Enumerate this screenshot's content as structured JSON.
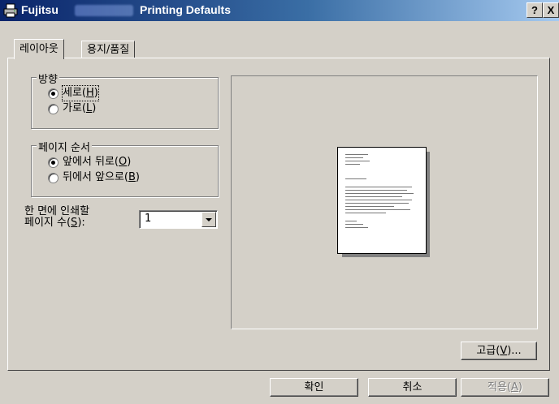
{
  "window": {
    "title_prefix": "Fujitsu",
    "title_suffix": "Printing Defaults",
    "help_button": "?",
    "close_button": "X"
  },
  "tabs": [
    {
      "label": "레이아웃",
      "selected": true
    },
    {
      "label": "용지/품질",
      "selected": false
    }
  ],
  "orientation": {
    "group_label": "방향",
    "options": [
      {
        "label_pre": "세로(",
        "key": "H",
        "label_post": ")",
        "checked": true
      },
      {
        "label_pre": "가로(",
        "key": "L",
        "label_post": ")",
        "checked": false
      }
    ]
  },
  "page_order": {
    "group_label": "페이지 순서",
    "options": [
      {
        "label_pre": "앞에서 뒤로(",
        "key": "O",
        "label_post": ")",
        "checked": true
      },
      {
        "label_pre": "뒤에서 앞으로(",
        "key": "B",
        "label_post": ")",
        "checked": false
      }
    ]
  },
  "pages_per_sheet": {
    "label_line1": "한 면에 인쇄할",
    "label_line2_pre": "페이지 수(",
    "label_line2_key": "S",
    "label_line2_post": "):",
    "value": "1"
  },
  "buttons": {
    "advanced_pre": "고급(",
    "advanced_key": "V",
    "advanced_post": ")...",
    "ok": "확인",
    "cancel": "취소",
    "apply_pre": "적용(",
    "apply_key": "A",
    "apply_post": ")"
  },
  "icons": {
    "app": "printer-icon",
    "dropdown": "chevron-down-icon"
  }
}
